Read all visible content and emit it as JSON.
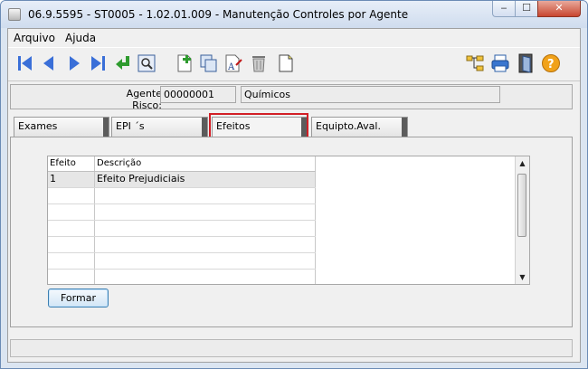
{
  "window": {
    "title": "06.9.5595 - ST0005 - 1.02.01.009 - Manutenção Controles por Agente",
    "minimize_label": "‒",
    "maximize_label": "☐",
    "close_label": "✕"
  },
  "menu": {
    "items": [
      {
        "label": "Arquivo"
      },
      {
        "label": "Ajuda"
      }
    ]
  },
  "toolbar": {
    "left": [
      "first-record-icon",
      "previous-record-icon",
      "next-record-icon",
      "last-record-icon",
      "goto-icon",
      "search-icon",
      "add-record-icon",
      "copy-record-icon",
      "edit-text-icon",
      "delete-icon",
      "new-document-icon"
    ],
    "right": [
      "tree-structure-icon",
      "print-icon",
      "exit-door-icon",
      "help-icon"
    ]
  },
  "form": {
    "agente_label": "Agente Risco:",
    "agente_code": "00000001",
    "agente_desc": "Químicos"
  },
  "tabs": [
    {
      "label": "Exames"
    },
    {
      "label": "EPI ´s"
    },
    {
      "label": "Efeitos",
      "selected": true
    },
    {
      "label": "Equipto.Aval."
    }
  ],
  "grid": {
    "columns": [
      "Efeito",
      "Descrição"
    ],
    "rows": [
      {
        "efeito": "1",
        "descricao": "Efeito Prejudiciais"
      }
    ],
    "scroll_up": "▲",
    "scroll_down": "▼"
  },
  "buttons": {
    "formar": "Formar"
  },
  "colors": {
    "highlight": "#d21f26",
    "tab_edge": "#5c5c5c",
    "button_border": "#3c7fb1"
  }
}
